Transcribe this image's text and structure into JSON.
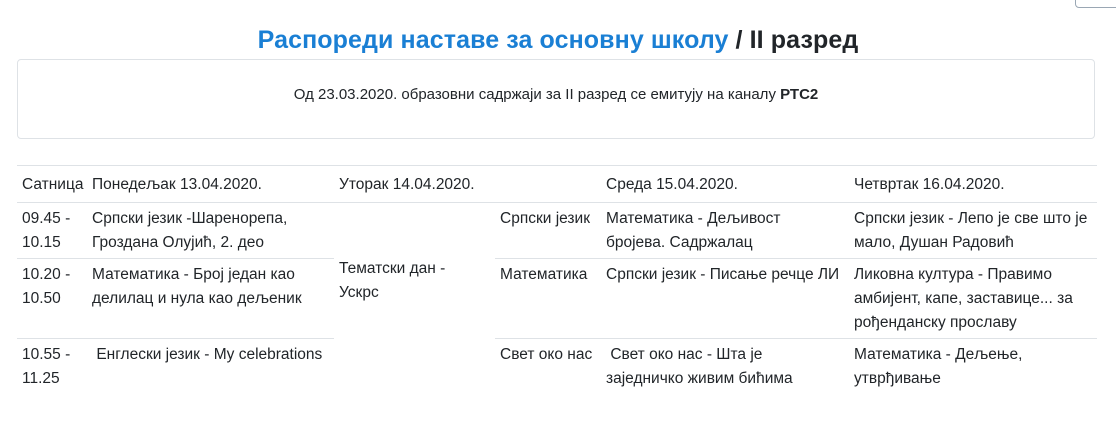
{
  "title": {
    "link_text": "Распореди наставе за основну школу",
    "rest_text": " / II разред"
  },
  "notice": {
    "text": "Од 23.03.2020. образовни садржаји за II разред се емитују на каналу ",
    "channel": "РТС2"
  },
  "table": {
    "headers": [
      "Сатница",
      "Понедељак 13.04.2020.",
      "Уторак 14.04.2020.",
      "",
      "Среда 15.04.2020.",
      "Четвртак 16.04.2020."
    ],
    "tuesday_merged": "Тематски дан - Ускрс",
    "rows": [
      {
        "time": "09.45 - 10.15",
        "monday": "Српски језик -Шаренорепа, Гроздана Олујић, 2. део",
        "wed_subject": "Српски језик",
        "wednesday": "Математика - Дељивост бројева. Садржалац",
        "thursday": "Српски језик - Лепо је све што је мало, Душан Радовић"
      },
      {
        "time": "10.20 - 10.50",
        "monday": "Математика - Број један као делилац и нула као дељеник",
        "wed_subject": "Математика",
        "wednesday": "Српски језик - Писање речце ЛИ",
        "thursday": "Ликовна култура - Правимо амбијент, капе, заставице... за рођенданску прославу"
      },
      {
        "time": "10.55 - 11.25",
        "monday": " Енглески језик - My celebrations",
        "wed_subject": "Свет око нас",
        "wednesday": " Свет око нас - Шта је заједничко живим бићима",
        "thursday": "Математика - Дељење, утврђивање"
      }
    ]
  }
}
